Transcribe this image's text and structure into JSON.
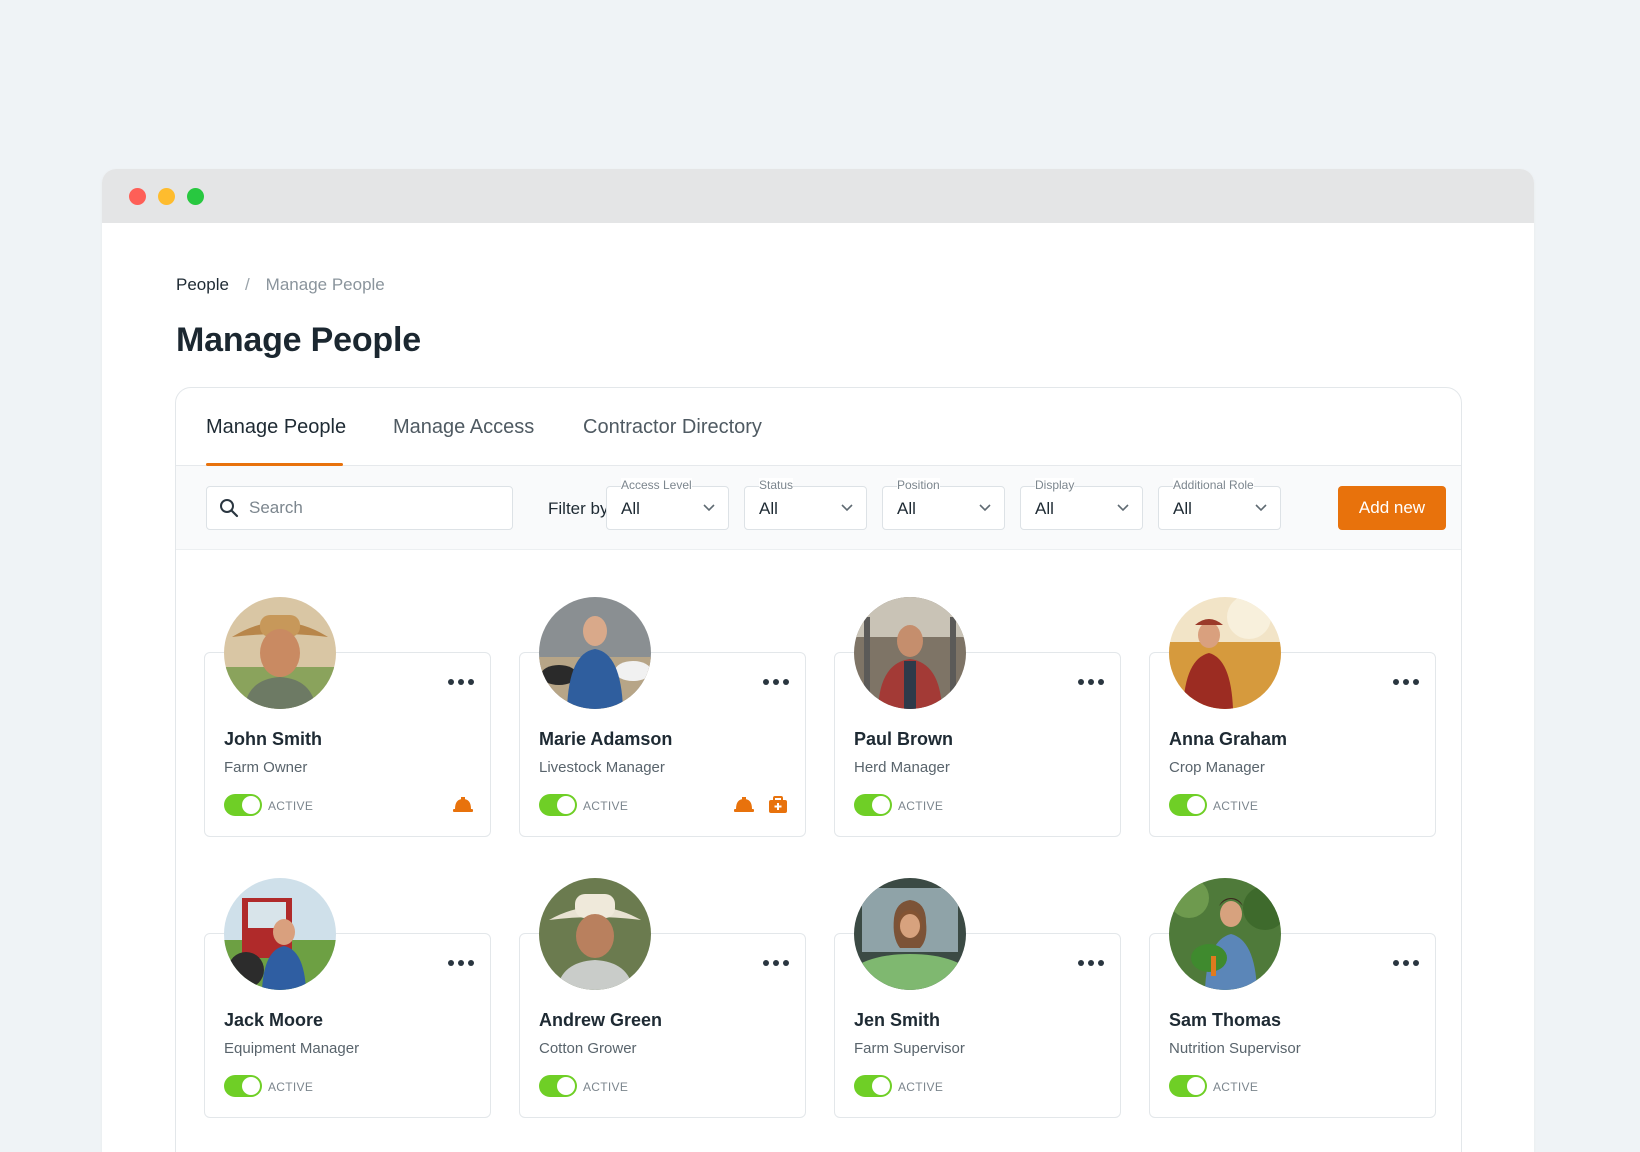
{
  "window": {
    "controls": [
      "close-dot",
      "minimize-dot",
      "maximize-dot"
    ]
  },
  "breadcrumb": {
    "root": "People",
    "separator": "/",
    "current": "Manage People"
  },
  "page_title": "Manage People",
  "tabs": [
    {
      "label": "Manage People",
      "active": true
    },
    {
      "label": "Manage Access",
      "active": false
    },
    {
      "label": "Contractor Directory",
      "active": false
    }
  ],
  "filters": {
    "search_placeholder": "Search",
    "filter_by_label": "Filter by",
    "selects": [
      {
        "label": "Access Level",
        "value": "All"
      },
      {
        "label": "Status",
        "value": "All"
      },
      {
        "label": "Position",
        "value": "All"
      },
      {
        "label": "Display",
        "value": "All"
      },
      {
        "label": "Additional Role",
        "value": "All"
      }
    ],
    "add_button": "Add new"
  },
  "colors": {
    "accent": "#e8720c",
    "toggle_on": "#6fcf26"
  },
  "people": [
    {
      "name": "John Smith",
      "role": "Farm Owner",
      "status": "ACTIVE",
      "badges": [
        "hard-hat-icon"
      ]
    },
    {
      "name": "Marie Adamson",
      "role": "Livestock Manager",
      "status": "ACTIVE",
      "badges": [
        "hard-hat-icon",
        "first-aid-kit-icon"
      ]
    },
    {
      "name": "Paul Brown",
      "role": "Herd Manager",
      "status": "ACTIVE",
      "badges": []
    },
    {
      "name": "Anna Graham",
      "role": "Crop Manager",
      "status": "ACTIVE",
      "badges": []
    },
    {
      "name": "Jack Moore",
      "role": "Equipment Manager",
      "status": "ACTIVE",
      "badges": []
    },
    {
      "name": "Andrew Green",
      "role": "Cotton Grower",
      "status": "ACTIVE",
      "badges": []
    },
    {
      "name": "Jen Smith",
      "role": "Farm Supervisor",
      "status": "ACTIVE",
      "badges": []
    },
    {
      "name": "Sam Thomas",
      "role": "Nutrition Supervisor",
      "status": "ACTIVE",
      "badges": []
    }
  ]
}
